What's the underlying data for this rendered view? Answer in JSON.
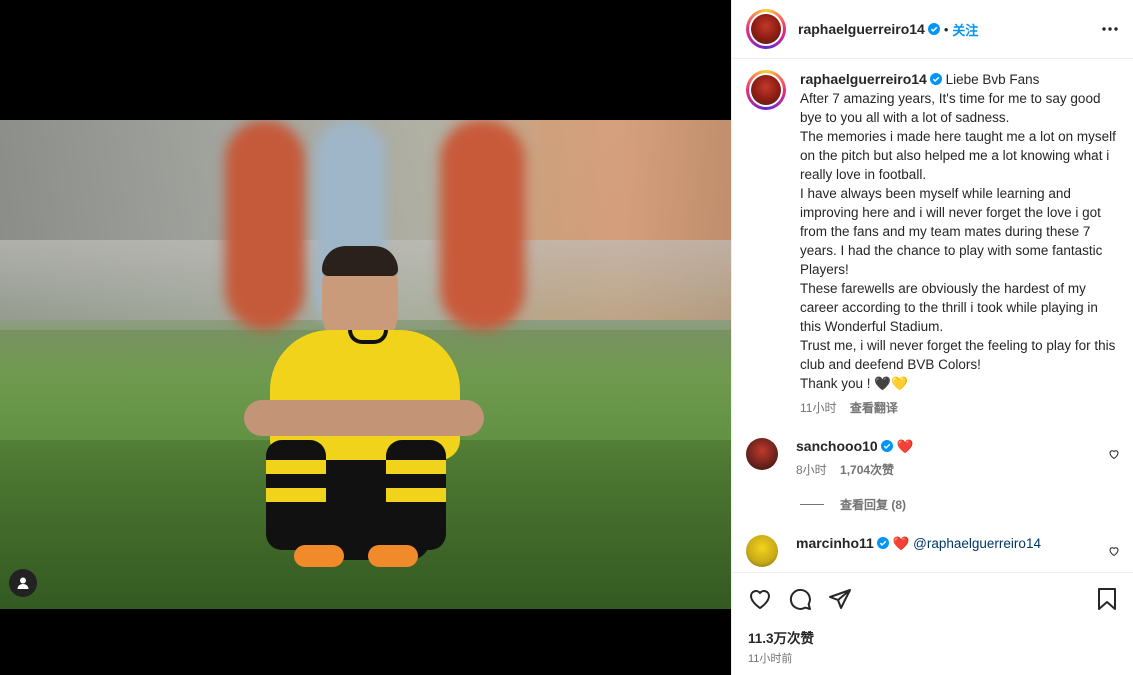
{
  "post": {
    "username": "raphaelguerreiro14",
    "separator": "•",
    "follow_label": "关注"
  },
  "caption": {
    "username": "raphaelguerreiro14",
    "lines": [
      "Liebe Bvb Fans",
      "After 7 amazing years, It's time for me to say good bye to you all with a lot of sadness.",
      "The memories i made here taught me a lot on myself on the pitch but also helped me a lot knowing what i really love in football.",
      "I have always been myself while learning and improving here and i will never forget the love i got from the fans and my team mates during these 7 years. I had the chance to play with some fantastic Players!",
      "These farewells are obviously the hardest of my career according to the thrill i took while playing in this Wonderful Stadium.",
      "Trust me, i will never forget the feeling to play for this club and deefend BVB Colors!",
      "Thank you ! 🖤💛"
    ],
    "time": "11小时",
    "translate_label": "查看翻译"
  },
  "comments": [
    {
      "username": "sanchooo10",
      "text": "❤️",
      "time": "8小时",
      "likes": "1,704次赞",
      "replies_label": "查看回复 (8)"
    },
    {
      "username": "marcinho11",
      "text": "❤️",
      "mention": "@raphaelguerreiro14"
    }
  ],
  "footer": {
    "likes_label": "11.3万次赞",
    "time_label": "11小时前"
  },
  "colors": {
    "link_blue": "#0095f6",
    "verified_blue": "#0095f6",
    "heart_red": "#ed1c24"
  }
}
